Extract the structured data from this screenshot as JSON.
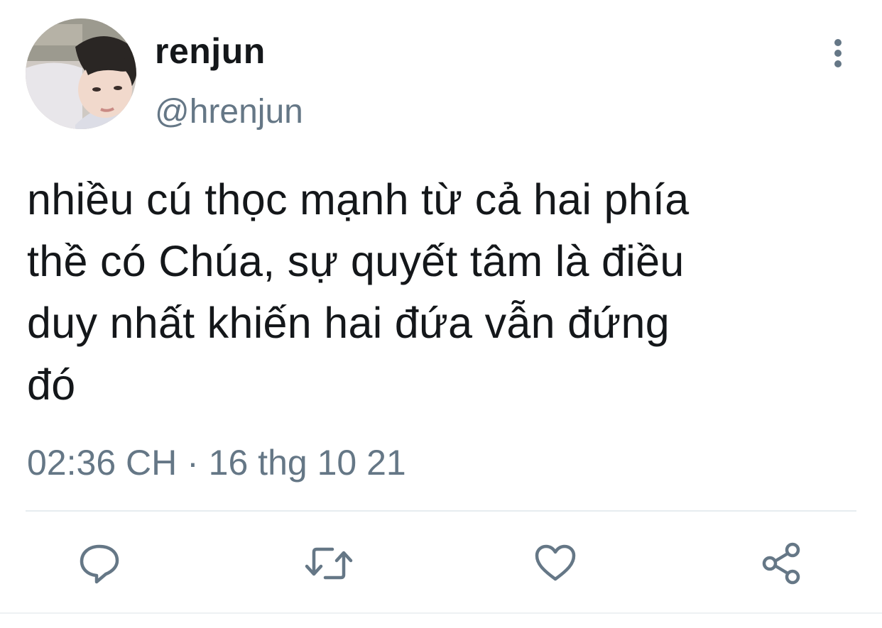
{
  "tweet": {
    "display_name": "renjun",
    "handle": "@hrenjun",
    "text": "nhiều cú thọc mạnh từ cả hai phía\nthề có Chúa, sự quyết tâm là điều\nduy nhất khiến hai đứa vẫn đứng\nđó",
    "timestamp": "02:36 CH · 16 thg 10 21"
  },
  "icons": {
    "more": "more-vertical-icon",
    "reply": "reply-bubble-icon",
    "retweet": "retweet-icon",
    "like": "heart-icon",
    "share": "share-icon"
  },
  "colors": {
    "text_primary": "#14171a",
    "text_secondary": "#657786",
    "icon": "#657786",
    "divider": "#e6ecf0"
  }
}
